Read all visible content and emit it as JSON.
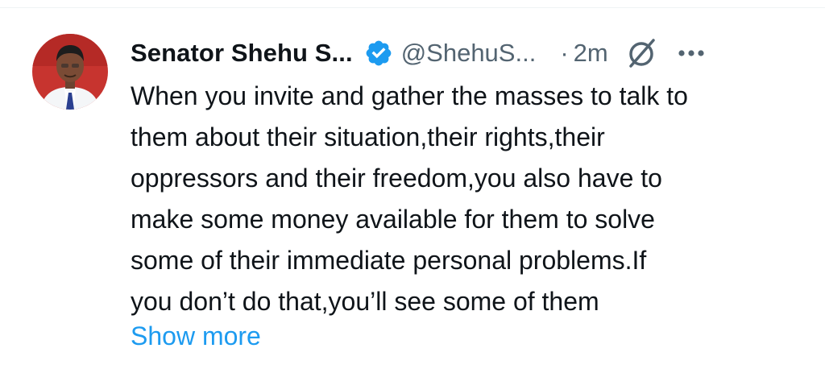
{
  "tweet": {
    "author": {
      "display_name": "Senator Shehu S...",
      "handle": "@ShehuS...",
      "verified": true,
      "avatar_icon": "profile-photo"
    },
    "separator": "·",
    "time": "2m",
    "header_icons": [
      "verified-badge-icon",
      "grok-icon",
      "more-options-icon"
    ],
    "text_lines": [
      "When you invite and gather the masses to talk to",
      "them about their situation,their rights,their",
      "oppressors and their freedom,you also have to",
      "make some money available for them to solve",
      "some of their immediate personal problems.If",
      "you don’t do that,you’ll see some of them"
    ],
    "show_more_label": "Show more"
  },
  "colors": {
    "text_primary": "#0f1419",
    "text_secondary": "#536471",
    "accent": "#1d9bf0"
  }
}
